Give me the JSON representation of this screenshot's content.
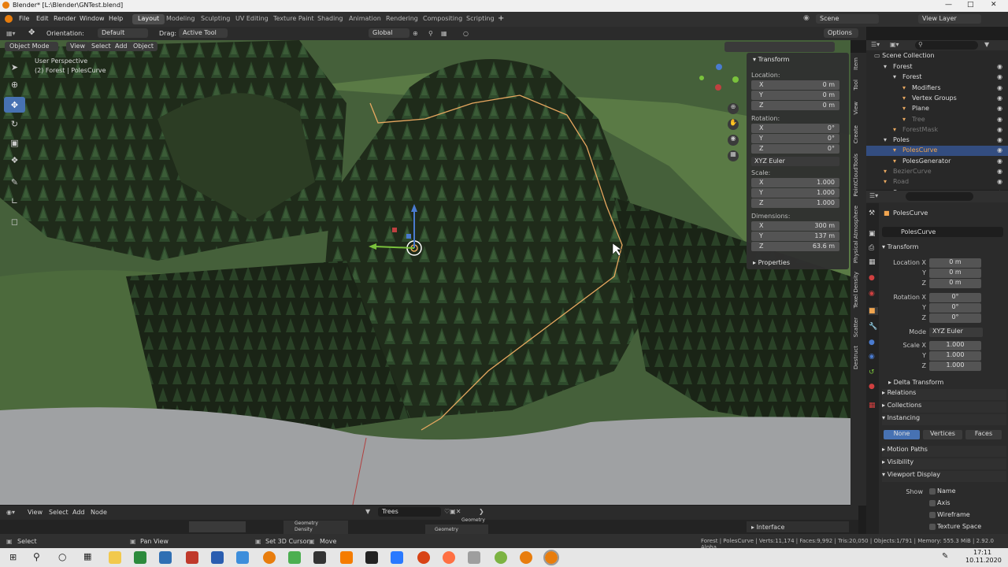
{
  "window": {
    "title": "Blender* [L:\\Blender\\GNTest.blend]"
  },
  "menu": {
    "items": [
      "File",
      "Edit",
      "Render",
      "Window",
      "Help"
    ],
    "workspaces": [
      "Layout",
      "Modeling",
      "Sculpting",
      "UV Editing",
      "Texture Paint",
      "Shading",
      "Animation",
      "Rendering",
      "Compositing",
      "Scripting"
    ],
    "scene": "Scene",
    "view_layer": "View Layer"
  },
  "header": {
    "orientation_label": "Orientation:",
    "orientation_value": "Default",
    "drag_label": "Drag:",
    "drag_value": "Active Tool",
    "transform_orientation": "Global",
    "options": "Options"
  },
  "viewport_header": {
    "mode": "Object Mode",
    "menus": [
      "View",
      "Select",
      "Add",
      "Object"
    ]
  },
  "viewport": {
    "perspective": "User Perspective",
    "object_info": "(2) Forest | PolesCurve"
  },
  "npanel": {
    "transform": "Transform",
    "location": "Location:",
    "rotation": "Rotation:",
    "scale": "Scale:",
    "dimensions": "Dimensions:",
    "euler": "XYZ Euler",
    "properties": "Properties",
    "loc": [
      {
        "axis": "X",
        "value": "0 m"
      },
      {
        "axis": "Y",
        "value": "0 m"
      },
      {
        "axis": "Z",
        "value": "0 m"
      }
    ],
    "rot": [
      {
        "axis": "X",
        "value": "0°"
      },
      {
        "axis": "Y",
        "value": "0°"
      },
      {
        "axis": "Z",
        "value": "0°"
      }
    ],
    "scl": [
      {
        "axis": "X",
        "value": "1.000"
      },
      {
        "axis": "Y",
        "value": "1.000"
      },
      {
        "axis": "Z",
        "value": "1.000"
      }
    ],
    "dim": [
      {
        "axis": "X",
        "value": "300 m"
      },
      {
        "axis": "Y",
        "value": "137 m"
      },
      {
        "axis": "Z",
        "value": "63.6 m"
      }
    ]
  },
  "side_tabs": [
    "Item",
    "Tool",
    "View",
    "Create",
    "PointCloudTools",
    "Physical Atmosphere",
    "Texel Density",
    "Scatter",
    "Destruct"
  ],
  "outliner": {
    "root": "Scene Collection",
    "items": [
      {
        "label": "Forest",
        "indent": 1,
        "color": "#ddd"
      },
      {
        "label": "Forest",
        "indent": 2,
        "color": "#ddd"
      },
      {
        "label": "Modifiers",
        "indent": 3,
        "color": "#ddd"
      },
      {
        "label": "Vertex Groups",
        "indent": 3,
        "color": "#ddd"
      },
      {
        "label": "Plane",
        "indent": 3,
        "color": "#ddd"
      },
      {
        "label": "Tree",
        "indent": 3,
        "color": "#777"
      },
      {
        "label": "ForestMask",
        "indent": 2,
        "color": "#777"
      },
      {
        "label": "Poles",
        "indent": 1,
        "color": "#ddd"
      },
      {
        "label": "PolesCurve",
        "indent": 2,
        "color": "#f0a550",
        "sel": true
      },
      {
        "label": "PolesGenerator",
        "indent": 2,
        "color": "#ddd"
      },
      {
        "label": "BezierCurve",
        "indent": 1,
        "color": "#777"
      },
      {
        "label": "Road",
        "indent": 1,
        "color": "#777"
      },
      {
        "label": "Sun",
        "indent": 1,
        "color": "#ddd"
      }
    ]
  },
  "props": {
    "object_name": "PolesCurve",
    "data_name": "PolesCurve",
    "transform": "Transform",
    "location_label": "Location X",
    "rotation_label": "Rotation X",
    "mode_label": "Mode",
    "mode_value": "XYZ Euler",
    "scale_label": "Scale X",
    "loc": [
      "0 m",
      "0 m",
      "0 m"
    ],
    "rot": [
      "0°",
      "0°",
      "0°"
    ],
    "scl": [
      "1.000",
      "1.000",
      "1.000"
    ],
    "y": "Y",
    "z": "Z",
    "delta": "Delta Transform",
    "relations": "Relations",
    "collections": "Collections",
    "instancing": "Instancing",
    "inst_opts": [
      "None",
      "Vertices",
      "Faces"
    ],
    "motion_paths": "Motion Paths",
    "visibility": "Visibility",
    "viewport_display": "Viewport Display",
    "show": "Show",
    "show_opts": [
      "Name",
      "Axis",
      "Wireframe",
      "Texture Space"
    ]
  },
  "node_editor": {
    "menus": [
      "View",
      "Select",
      "Add",
      "Node"
    ],
    "tree": "Trees",
    "nodes": [
      "Geometry",
      "Density",
      "Geometry",
      "Geometry"
    ],
    "interface": "Interface"
  },
  "status": {
    "select": "Select",
    "pan": "Pan View",
    "cursor": "Set 3D Cursor",
    "move": "Move",
    "info": "Forest | PolesCurve | Verts:11,174 | Faces:9,992 | Tris:20,050 | Objects:1/791 | Memory: 555.3 MiB | 2.92.0 Alpha"
  },
  "taskbar": {
    "time": "17:11",
    "date": "10.11.2020"
  }
}
